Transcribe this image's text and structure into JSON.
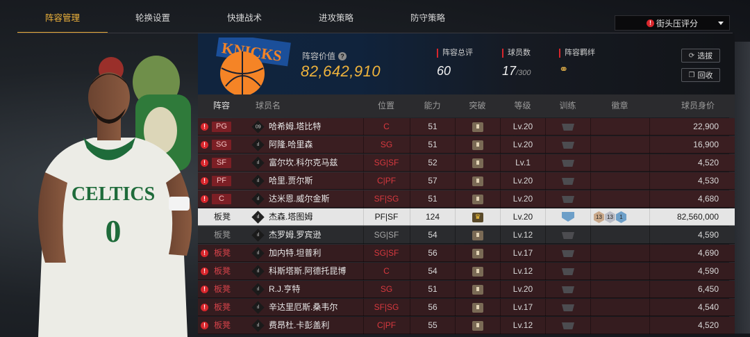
{
  "nav": {
    "tabs": [
      "阵容管理",
      "轮换设置",
      "快捷战术",
      "进攻策略",
      "防守策略"
    ],
    "dropdown_label": "街头压评分"
  },
  "header": {
    "lineup_value_label": "阵容价值",
    "lineup_value": "82,642,910",
    "stats": [
      {
        "label": "阵容总评",
        "value": "60"
      },
      {
        "label": "球员数",
        "value": "17",
        "max": "/300"
      },
      {
        "label": "阵容羁绊"
      }
    ],
    "buttons": {
      "select": "选拔",
      "recycle": "回收"
    }
  },
  "table": {
    "columns": [
      "阵容",
      "球员名",
      "位置",
      "能力",
      "突破",
      "等级",
      "训练",
      "徽章",
      "球员身价"
    ],
    "rows": [
      {
        "lineup": "PG",
        "type": "starter",
        "warn": true,
        "num": "09",
        "name": "哈希姆.塔比特",
        "pos": "C",
        "pos_style": "red",
        "ability": "51",
        "level": "Lv.20",
        "value": "22,900"
      },
      {
        "lineup": "SG",
        "type": "starter",
        "warn": true,
        "num": "ıl",
        "name": "阿隆.哈里森",
        "pos": "SG",
        "pos_style": "red",
        "ability": "51",
        "level": "Lv.20",
        "value": "16,900"
      },
      {
        "lineup": "SF",
        "type": "starter",
        "warn": true,
        "num": "ıl",
        "name": "富尔坎.科尔克马兹",
        "pos": "SG|SF",
        "pos_style": "red",
        "ability": "52",
        "level": "Lv.1",
        "value": "4,520"
      },
      {
        "lineup": "PF",
        "type": "starter",
        "warn": true,
        "num": "ıl",
        "name": "哈里.贾尔斯",
        "pos": "C|PF",
        "pos_style": "red",
        "ability": "57",
        "level": "Lv.20",
        "value": "4,530"
      },
      {
        "lineup": "C",
        "type": "starter",
        "warn": true,
        "num": "ıl",
        "name": "达米恩.威尔金斯",
        "pos": "SF|SG",
        "pos_style": "red",
        "ability": "51",
        "level": "Lv.20",
        "value": "4,680"
      },
      {
        "lineup": "板凳",
        "type": "selected",
        "warn": false,
        "num": "ıl",
        "name": "杰森.塔图姆",
        "pos": "PF|SF",
        "pos_style": "norm",
        "ability": "124",
        "level": "Lv.20",
        "value": "82,560,000",
        "badges": [
          "13",
          "13",
          "1"
        ]
      },
      {
        "lineup": "板凳",
        "type": "bench-gray",
        "warn": false,
        "num": "ıl",
        "name": "杰罗姆.罗宾逊",
        "pos": "SG|SF",
        "pos_style": "gray",
        "ability": "54",
        "level": "Lv.12",
        "value": "4,590"
      },
      {
        "lineup": "板凳",
        "type": "bench-red",
        "warn": true,
        "num": "ıl",
        "name": "加内特.坦普利",
        "pos": "SG|SF",
        "pos_style": "red",
        "ability": "56",
        "level": "Lv.17",
        "value": "4,690"
      },
      {
        "lineup": "板凳",
        "type": "bench-red",
        "warn": true,
        "num": "ıl",
        "name": "科斯塔斯.阿德托昆博",
        "pos": "C",
        "pos_style": "red",
        "ability": "54",
        "level": "Lv.12",
        "value": "4,590"
      },
      {
        "lineup": "板凳",
        "type": "bench-red",
        "warn": true,
        "num": "ıl",
        "name": "R.J.亨特",
        "pos": "SG",
        "pos_style": "red",
        "ability": "51",
        "level": "Lv.20",
        "value": "6,450"
      },
      {
        "lineup": "板凳",
        "type": "bench-red",
        "warn": true,
        "num": "ıl",
        "name": "辛达里厄斯.桑韦尔",
        "pos": "SF|SG",
        "pos_style": "red",
        "ability": "56",
        "level": "Lv.17",
        "value": "4,540"
      },
      {
        "lineup": "板凳",
        "type": "bench-red",
        "warn": true,
        "num": "ıl",
        "name": "费昂杜.卡彭盖利",
        "pos": "C|PF",
        "pos_style": "red",
        "ability": "55",
        "level": "Lv.12",
        "value": "4,520"
      }
    ]
  },
  "art": {
    "jersey_text": "CELTICS",
    "jersey_number": "0",
    "logo_text": "KNICKS"
  }
}
